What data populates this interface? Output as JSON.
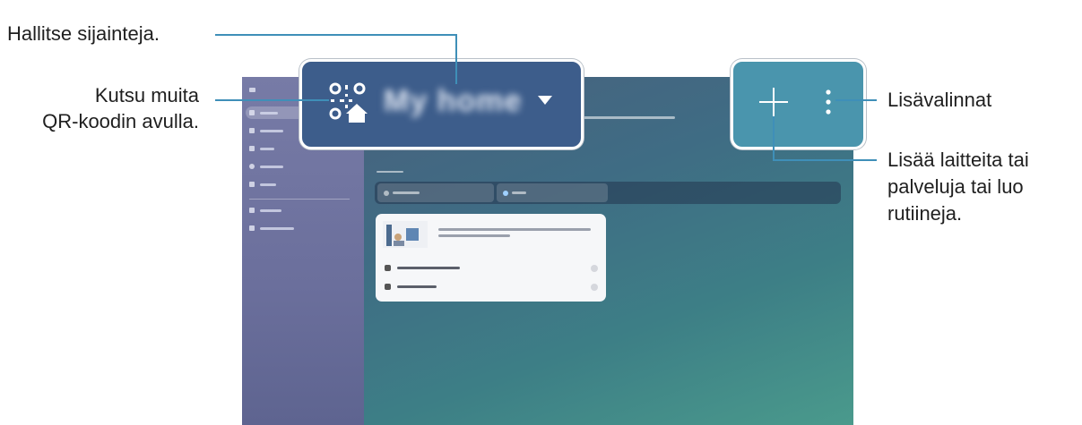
{
  "callouts": {
    "manage_locations": "Hallitse sijainteja.",
    "invite_line1": "Kutsu muita",
    "invite_line2": "QR-koodin avulla.",
    "more_options": "Lisävalinnat",
    "add_line1": "Lisää laitteita tai",
    "add_line2": "palveluja tai luo",
    "add_line3": "rutiineja."
  },
  "header": {
    "location_title": "My home"
  },
  "colors": {
    "callout_line": "#3f8fb8",
    "header_panel": "#3d5d8b",
    "actions_panel": "#4a95ad",
    "sidebar": "#6f73a0"
  },
  "icons": {
    "qr_invite": "qr-home-icon",
    "location_dropdown": "caret-down-icon",
    "add": "plus-icon",
    "more": "kebab-icon"
  }
}
